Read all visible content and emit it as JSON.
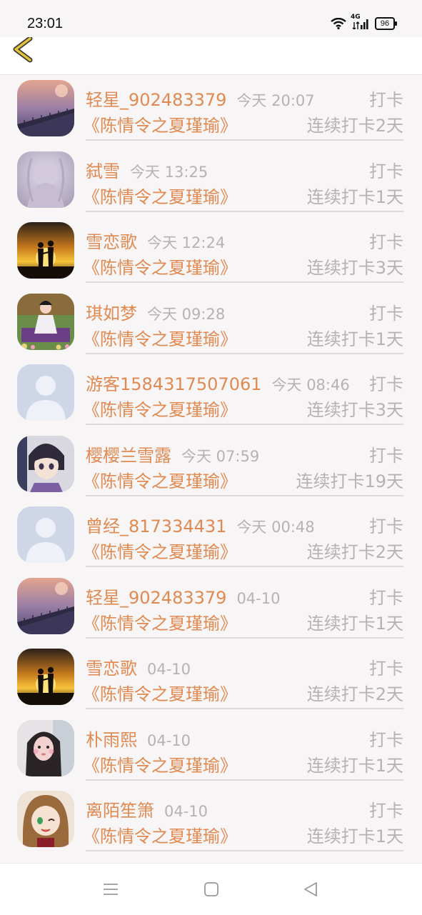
{
  "status_bar": {
    "time": "23:01",
    "network": "4G",
    "battery": "96"
  },
  "header": {
    "back_icon": "chevron-left-icon",
    "accent": "#e2c23a"
  },
  "colors": {
    "name": "#e08a52",
    "muted": "#b6b2b3",
    "background": "#f7f5f6"
  },
  "checkins": [
    {
      "user": "轻星_902483379",
      "time": "今天 20:07",
      "action": "打卡",
      "book": "《陈情令之夏瑾瑜》",
      "streak": "连续打卡2天",
      "avatar": "dusk-bridge"
    },
    {
      "user": "弑雪",
      "time": "今天 13:25",
      "action": "打卡",
      "book": "《陈情令之夏瑾瑜》",
      "streak": "连续打卡1天",
      "avatar": "misty-figure"
    },
    {
      "user": "雪恋歌",
      "time": "今天 12:24",
      "action": "打卡",
      "book": "《陈情令之夏瑾瑜》",
      "streak": "连续打卡3天",
      "avatar": "sunset-couple"
    },
    {
      "user": "琪如梦",
      "time": "今天 09:28",
      "action": "打卡",
      "book": "《陈情令之夏瑾瑜》",
      "streak": "连续打卡1天",
      "avatar": "game-character"
    },
    {
      "user": "游客1584317507061",
      "time": "今天 08:46",
      "action": "打卡",
      "book": "《陈情令之夏瑾瑜》",
      "streak": "连续打卡3天",
      "avatar": "default"
    },
    {
      "user": "樱樱兰雪露",
      "time": "今天 07:59",
      "action": "打卡",
      "book": "《陈情令之夏瑾瑜》",
      "streak": "连续打卡19天",
      "avatar": "anime-boy"
    },
    {
      "user": "曾经_817334431",
      "time": "今天 00:48",
      "action": "打卡",
      "book": "《陈情令之夏瑾瑜》",
      "streak": "连续打卡2天",
      "avatar": "default"
    },
    {
      "user": "轻星_902483379",
      "time": "04-10",
      "action": "打卡",
      "book": "《陈情令之夏瑾瑜》",
      "streak": "连续打卡1天",
      "avatar": "dusk-bridge"
    },
    {
      "user": "雪恋歌",
      "time": "04-10",
      "action": "打卡",
      "book": "《陈情令之夏瑾瑜》",
      "streak": "连续打卡2天",
      "avatar": "sunset-couple"
    },
    {
      "user": "朴雨熙",
      "time": "04-10",
      "action": "打卡",
      "book": "《陈情令之夏瑾瑜》",
      "streak": "连续打卡1天",
      "avatar": "girl-photo"
    },
    {
      "user": "离陌笙箫",
      "time": "04-10",
      "action": "打卡",
      "book": "《陈情令之夏瑾瑜》",
      "streak": "连续打卡1天",
      "avatar": "anime-girl"
    }
  ],
  "nav_bar": {
    "menu_icon": "menu-icon",
    "home_icon": "home-square-icon",
    "back_icon": "back-triangle-icon"
  }
}
